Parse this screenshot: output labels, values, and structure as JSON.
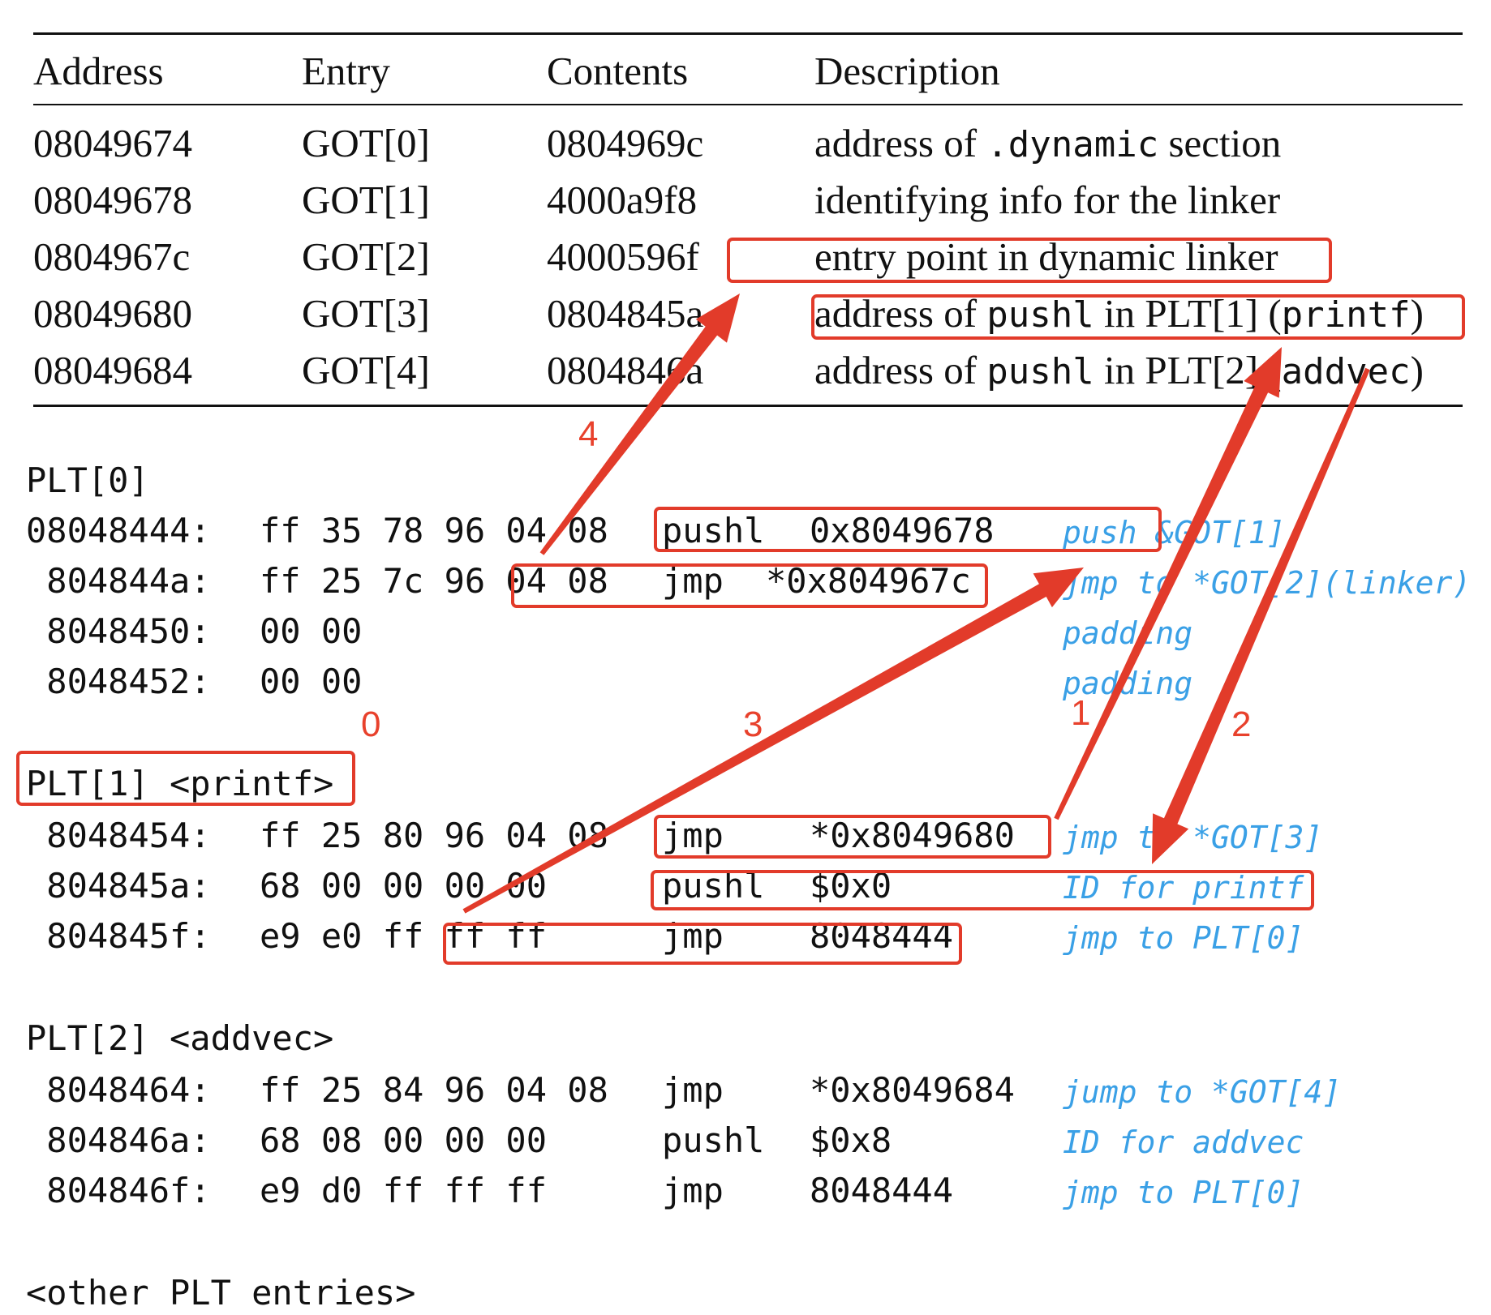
{
  "got_table": {
    "headers": [
      "Address",
      "Entry",
      "Contents",
      "Description"
    ],
    "rows": [
      {
        "address": "08049674",
        "entry": "GOT[0]",
        "contents": "0804969c",
        "desc_pre": "address of ",
        "desc_code": ".dynamic",
        "desc_post": " section"
      },
      {
        "address": "08049678",
        "entry": "GOT[1]",
        "contents": "4000a9f8",
        "desc_pre": "identifying info for the linker",
        "desc_code": "",
        "desc_post": ""
      },
      {
        "address": "0804967c",
        "entry": "GOT[2]",
        "contents": "4000596f",
        "desc_pre": "entry point in dynamic linker",
        "desc_code": "",
        "desc_post": ""
      },
      {
        "address": "08049680",
        "entry": "GOT[3]",
        "contents": "0804845a",
        "desc_pre": "address of ",
        "desc_code": "pushl",
        "desc_post": " in PLT[1] (",
        "desc_code2": "printf",
        "desc_post2": ")"
      },
      {
        "address": "08049684",
        "entry": "GOT[4]",
        "contents": "0804846a",
        "desc_pre": "address of ",
        "desc_code": "pushl",
        "desc_post": " in PLT[2] (",
        "desc_code2": "addvec",
        "desc_post2": ")"
      }
    ]
  },
  "plt": {
    "plt0": {
      "title": "PLT[0]",
      "lines": [
        {
          "addr": "08048444:",
          "bytes": "ff 35 78 96 04 08",
          "op": "pushl",
          "arg": "0x8049678",
          "comment": "push &GOT[1]"
        },
        {
          "addr": " 804844a:",
          "bytes": "ff 25 7c 96 04 08",
          "op": "jmp",
          "arg": "*0x804967c",
          "comment": "jmp to *GOT[2](linker)"
        },
        {
          "addr": " 8048450:",
          "bytes": "00 00",
          "op": "",
          "arg": "",
          "comment": "padding"
        },
        {
          "addr": " 8048452:",
          "bytes": "00 00",
          "op": "",
          "arg": "",
          "comment": "padding"
        }
      ]
    },
    "plt1": {
      "title": "PLT[1] <printf>",
      "lines": [
        {
          "addr": " 8048454:",
          "bytes": "ff 25 80 96 04 08",
          "op": "jmp",
          "arg": "*0x8049680",
          "comment": "jmp to *GOT[3]"
        },
        {
          "addr": " 804845a:",
          "bytes": "68 00 00 00 00",
          "op": "pushl",
          "arg": "$0x0",
          "comment": "ID for printf"
        },
        {
          "addr": " 804845f:",
          "bytes": "e9 e0 ff ff ff",
          "op": "jmp",
          "arg": "8048444",
          "comment": "jmp to PLT[0]"
        }
      ]
    },
    "plt2": {
      "title": "PLT[2] <addvec>",
      "lines": [
        {
          "addr": " 8048464:",
          "bytes": "ff 25 84 96 04 08",
          "op": "jmp",
          "arg": "*0x8049684",
          "comment": "jump to *GOT[4]"
        },
        {
          "addr": " 804846a:",
          "bytes": "68 08 00 00 00",
          "op": "pushl",
          "arg": "$0x8",
          "comment": "ID for addvec"
        },
        {
          "addr": " 804846f:",
          "bytes": "e9 d0 ff ff ff",
          "op": "jmp",
          "arg": "8048444",
          "comment": "jmp to PLT[0]"
        }
      ]
    },
    "other": "<other PLT entries>"
  },
  "annotations": {
    "step_labels": [
      "0",
      "1",
      "2",
      "3",
      "4"
    ],
    "color": "#e23b2a"
  }
}
